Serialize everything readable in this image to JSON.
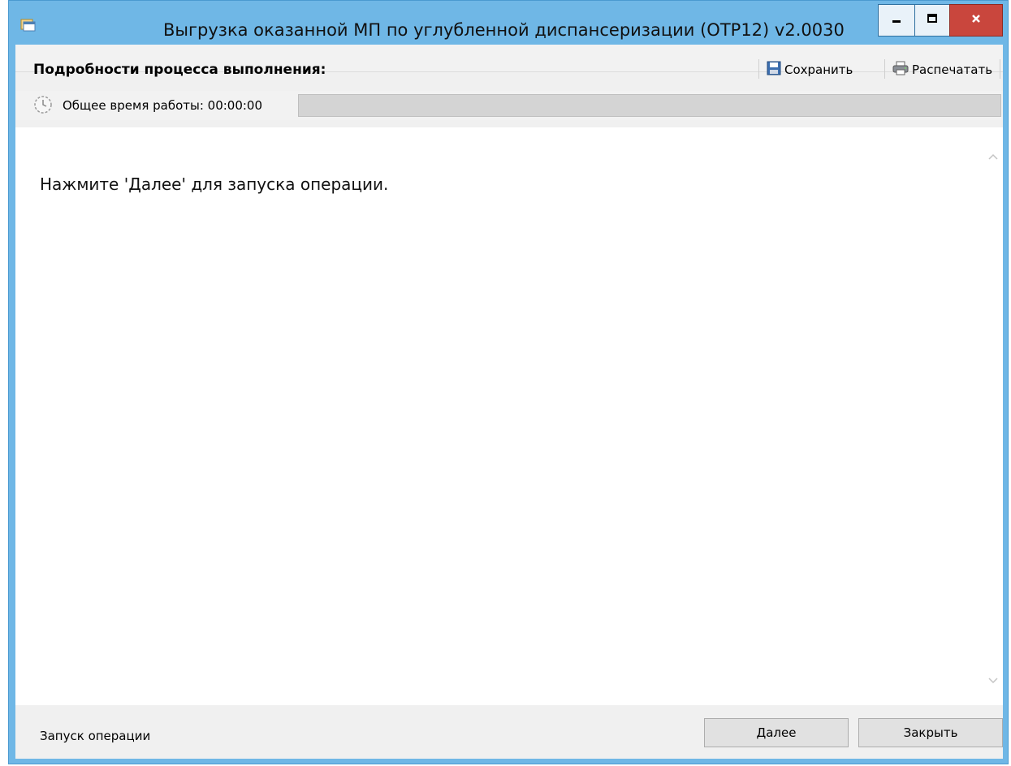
{
  "window": {
    "title": "Выгрузка  оказанной МП по углубленной диспансеризации (ОТР12) v2.0030"
  },
  "toolbar": {
    "title": "Подробности процесса выполнения:",
    "save_label": "Сохранить",
    "print_label": "Распечатать"
  },
  "timebar": {
    "label": "Общее время работы: 00:00:00",
    "progress": 0
  },
  "content": {
    "message": "Нажмите 'Далее' для запуска операции."
  },
  "footer": {
    "status": "Запуск операции",
    "next_label": "Далее",
    "close_label": "Закрыть"
  },
  "icons": {
    "app": "app-window-icon",
    "save": "floppy-disk-icon",
    "print": "printer-icon",
    "clock": "clock-icon"
  },
  "colors": {
    "frame": "#6fb7e6",
    "close_button": "#c9463d",
    "progress_track": "#d4d4d4"
  }
}
